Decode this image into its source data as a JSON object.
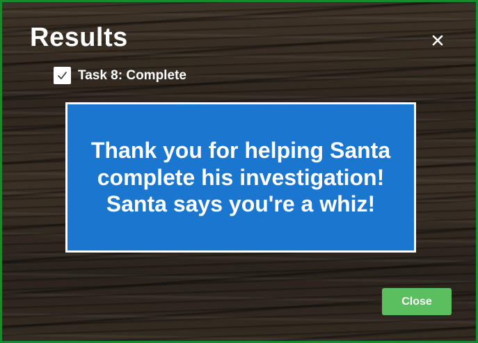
{
  "dialog": {
    "title": "Results",
    "close_icon": "close-icon",
    "task": {
      "checked": true,
      "label": "Task 8: Complete"
    },
    "message": "Thank you for helping Santa complete his investigation! Santa says you're a whiz!",
    "close_button_label": "Close"
  },
  "colors": {
    "frame_border": "#1c8a2c",
    "message_background": "#1b76d0",
    "close_button": "#5cbf5f",
    "text": "#ffffff"
  }
}
